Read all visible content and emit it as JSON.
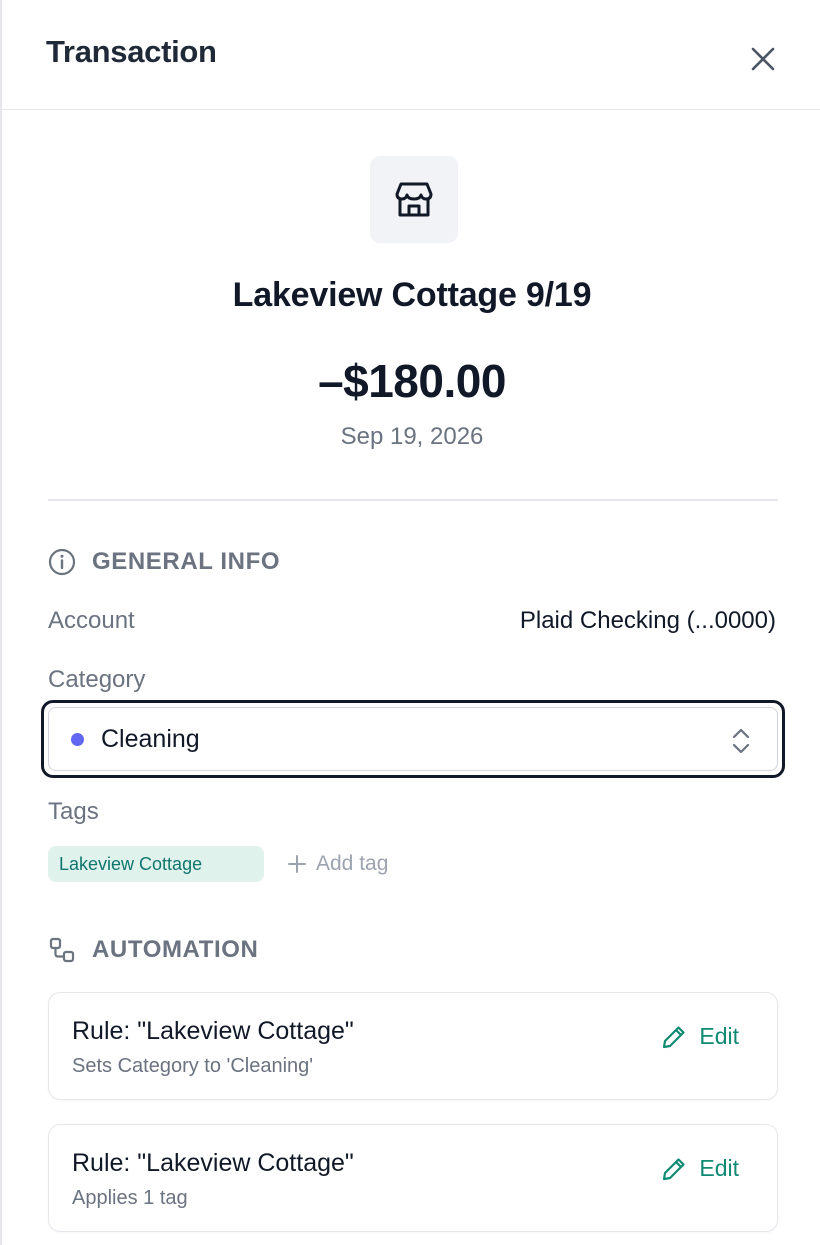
{
  "header": {
    "title": "Transaction"
  },
  "transaction": {
    "merchant_icon": "storefront-icon",
    "name": "Lakeview Cottage 9/19",
    "amount": "–$180.00",
    "date": "Sep 19, 2026"
  },
  "general_info": {
    "heading": "GENERAL INFO",
    "account_label": "Account",
    "account_value": "Plaid Checking (...0000)",
    "category_label": "Category",
    "category_value": "Cleaning",
    "category_color": "#6366f1",
    "tags_label": "Tags",
    "tags": [
      "Lakeview Cottage"
    ],
    "add_tag_label": "Add tag"
  },
  "automation": {
    "heading": "AUTOMATION",
    "rules": [
      {
        "title": "Rule: \"Lakeview Cottage\"",
        "description": "Sets Category to 'Cleaning'",
        "edit_label": "Edit"
      },
      {
        "title": "Rule: \"Lakeview Cottage\"",
        "description": "Applies 1 tag",
        "edit_label": "Edit"
      }
    ]
  },
  "colors": {
    "accent_green": "#0f8a73",
    "tag_background": "#dff2ec",
    "text_primary": "#111827",
    "text_muted": "#6b7280"
  }
}
